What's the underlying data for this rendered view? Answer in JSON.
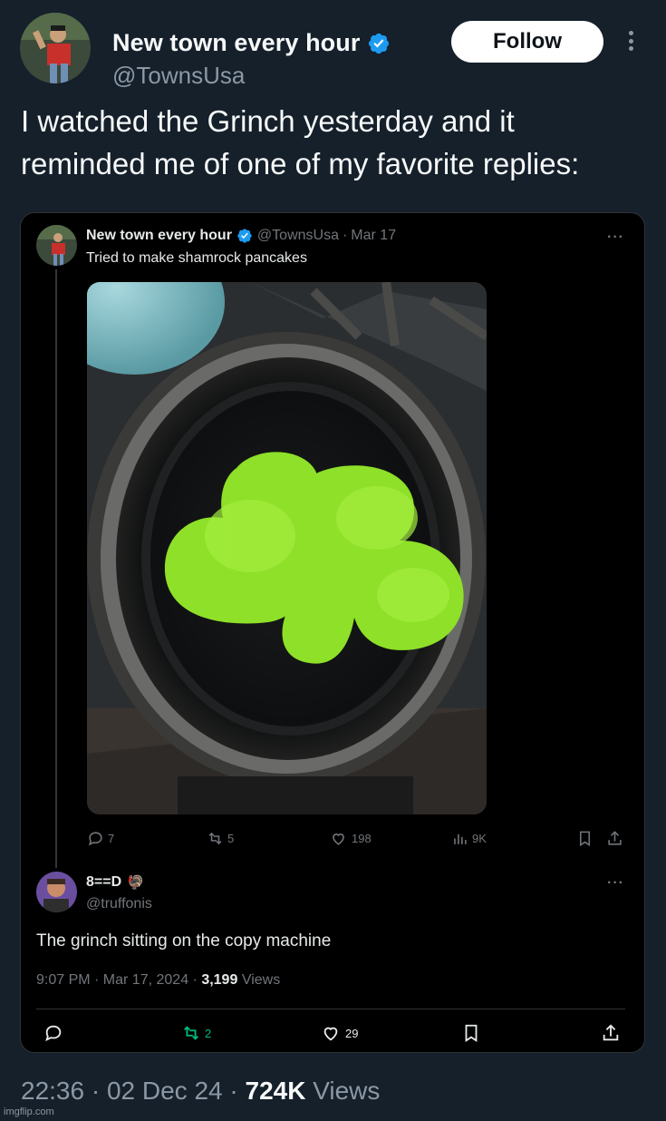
{
  "tweet": {
    "display_name": "New town every hour",
    "handle": "@TownsUsa",
    "follow_label": "Follow",
    "text": "I watched the Grinch yesterday and it reminded me of one of my favorite replies:",
    "time": "22:36",
    "date": "02 Dec 24",
    "views_count": "724K",
    "views_label": "Views",
    "separator": "·"
  },
  "embedded": {
    "original": {
      "display_name": "New town every hour",
      "handle": "@TownsUsa",
      "date": "Mar 17",
      "separator": "·",
      "text": "Tried to make shamrock pancakes",
      "more": "···",
      "replies": "7",
      "reposts": "5",
      "likes": "198",
      "views": "9K"
    },
    "reply": {
      "display_name": "8==D",
      "emoji": "🦃",
      "handle": "@truffonis",
      "text": "The grinch sitting on the copy machine",
      "time_date": "9:07 PM · Mar 17, 2024 ·",
      "views_count": "3,199",
      "views_label": "Views",
      "more": "···",
      "reposts": "2",
      "likes": "29"
    }
  },
  "watermark": "imgflip.com",
  "colors": {
    "background": "#15202b",
    "card": "#000000",
    "verified": "#1d9bf0",
    "repost_active": "#00ba7c",
    "muted": "#8b98a5",
    "pancake": "#8ee028"
  }
}
